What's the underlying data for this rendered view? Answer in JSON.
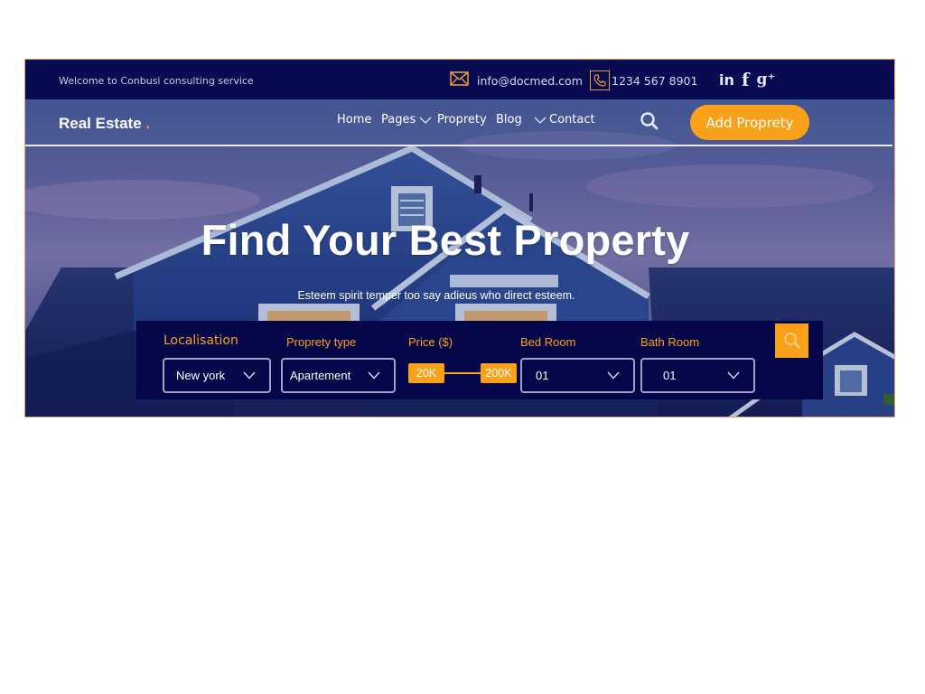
{
  "topbar": {
    "welcome": "Welcome to Conbusi consulting service",
    "email": "info@docmed.com",
    "phone": "1234 567 8901",
    "social": {
      "linkedin": "in",
      "facebook": "f",
      "gplus": "g⁺"
    }
  },
  "nav": {
    "brand": "Real Estate",
    "brand_dot": ".",
    "items": [
      {
        "label": "Home"
      },
      {
        "label": "Pages"
      },
      {
        "label": "Proprety"
      },
      {
        "label": "Blog"
      },
      {
        "label": "Contact"
      }
    ],
    "cta": "Add Proprety"
  },
  "hero": {
    "title": "Find Your Best Property",
    "subtitle": "Esteem spirit temper too say adieus who direct esteem."
  },
  "search": {
    "localisation": {
      "label": "Localisation",
      "value": "New york"
    },
    "type": {
      "label": "Proprety type",
      "value": "Apartement"
    },
    "price": {
      "label": "Price ($)",
      "min": "20K",
      "max": "200K"
    },
    "bed": {
      "label": "Bed Room",
      "value": "01"
    },
    "bath": {
      "label": "Bath Room",
      "value": "01"
    }
  },
  "colors": {
    "accent": "#f9a11a",
    "navy": "#080a52"
  },
  "icons": [
    "envelope-icon",
    "phone-icon",
    "linkedin-icon",
    "facebook-icon",
    "google-plus-icon",
    "search-icon",
    "chevron-down-icon"
  ]
}
